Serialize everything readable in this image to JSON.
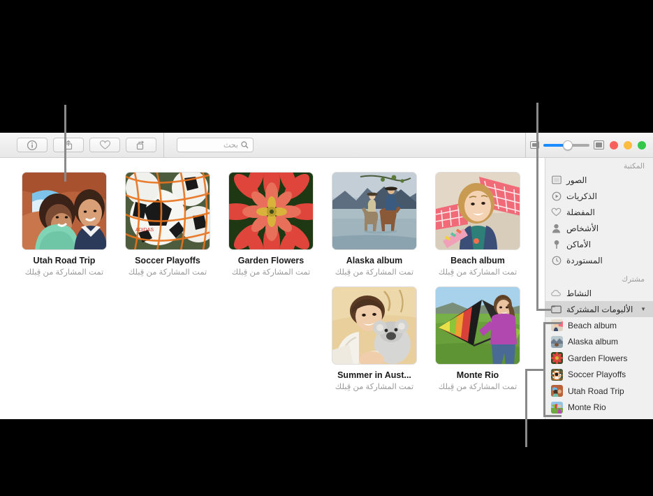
{
  "window": {
    "title": "الألبومات المشتركة",
    "traffic_lights": [
      "close-red",
      "minimize-yellow",
      "zoom-green"
    ]
  },
  "toolbar": {
    "search_placeholder": "بحث",
    "search_value": "",
    "buttons": [
      {
        "name": "rotate-button",
        "icon": "rotate-icon"
      },
      {
        "name": "favorite-button",
        "icon": "heart-icon"
      },
      {
        "name": "share-button",
        "icon": "share-icon"
      },
      {
        "name": "info-button",
        "icon": "info-icon"
      }
    ],
    "zoom_slider": {
      "min_icon": "small-photo-icon",
      "max_icon": "large-photo-icon",
      "value": 45
    }
  },
  "sidebar": {
    "sections": [
      {
        "header": "المكتبة",
        "items": [
          {
            "label": "الصور",
            "icon": "photos-icon",
            "selected": false
          },
          {
            "label": "الذكريات",
            "icon": "memories-icon",
            "selected": false
          },
          {
            "label": "المفضلة",
            "icon": "heart-icon",
            "selected": false
          },
          {
            "label": "الأشخاص",
            "icon": "people-icon",
            "selected": false
          },
          {
            "label": "الأماكن",
            "icon": "places-pin-icon",
            "selected": false
          },
          {
            "label": "المستوردة",
            "icon": "imported-clock-icon",
            "selected": false
          }
        ]
      },
      {
        "header": "مشترك",
        "items": [
          {
            "label": "النشاط",
            "icon": "cloud-icon",
            "selected": false
          },
          {
            "label": "الألبومات المشتركة",
            "icon": "shared-albums-icon",
            "selected": true,
            "disclosure": "▼"
          }
        ]
      }
    ],
    "shared_albums": [
      {
        "label": "Beach album",
        "thumb": "beach"
      },
      {
        "label": "Alaska album",
        "thumb": "alaska"
      },
      {
        "label": "Garden Flowers",
        "thumb": "flower"
      },
      {
        "label": "Soccer Playoffs",
        "thumb": "soccer"
      },
      {
        "label": "Utah Road Trip",
        "thumb": "utah"
      },
      {
        "label": "Monte Rio",
        "thumb": "kite"
      }
    ]
  },
  "content": {
    "shared_by_you": "تمت المشاركة من قِبلك",
    "albums": [
      {
        "name": "Utah Road Trip",
        "subtitle": "تمت المشاركة من قِبلك",
        "thumb": "utah"
      },
      {
        "name": "Soccer Playoffs",
        "subtitle": "تمت المشاركة من قِبلك",
        "thumb": "soccer"
      },
      {
        "name": "Garden Flowers",
        "subtitle": "تمت المشاركة من قِبلك",
        "thumb": "flower"
      },
      {
        "name": "Alaska album",
        "subtitle": "تمت المشاركة من قِبلك",
        "thumb": "alaska"
      },
      {
        "name": "Beach album",
        "subtitle": "تمت المشاركة من قِبلك",
        "thumb": "beach"
      },
      {
        "name": "Summer in Aust...",
        "subtitle": "تمت المشاركة من قِبلك",
        "thumb": "koala"
      },
      {
        "name": "Monte Rio",
        "subtitle": "تمت المشاركة من قِبلك",
        "thumb": "kite"
      }
    ]
  },
  "colors": {
    "accent_blue": "#1a8cff",
    "selected_row": "#d6d6d6",
    "sidebar_bg": "#f0f0f0",
    "callout_line": "#8a8a8a",
    "traffic_red": "#fc605c",
    "traffic_yellow": "#fdbc40",
    "traffic_green": "#34c84a"
  }
}
